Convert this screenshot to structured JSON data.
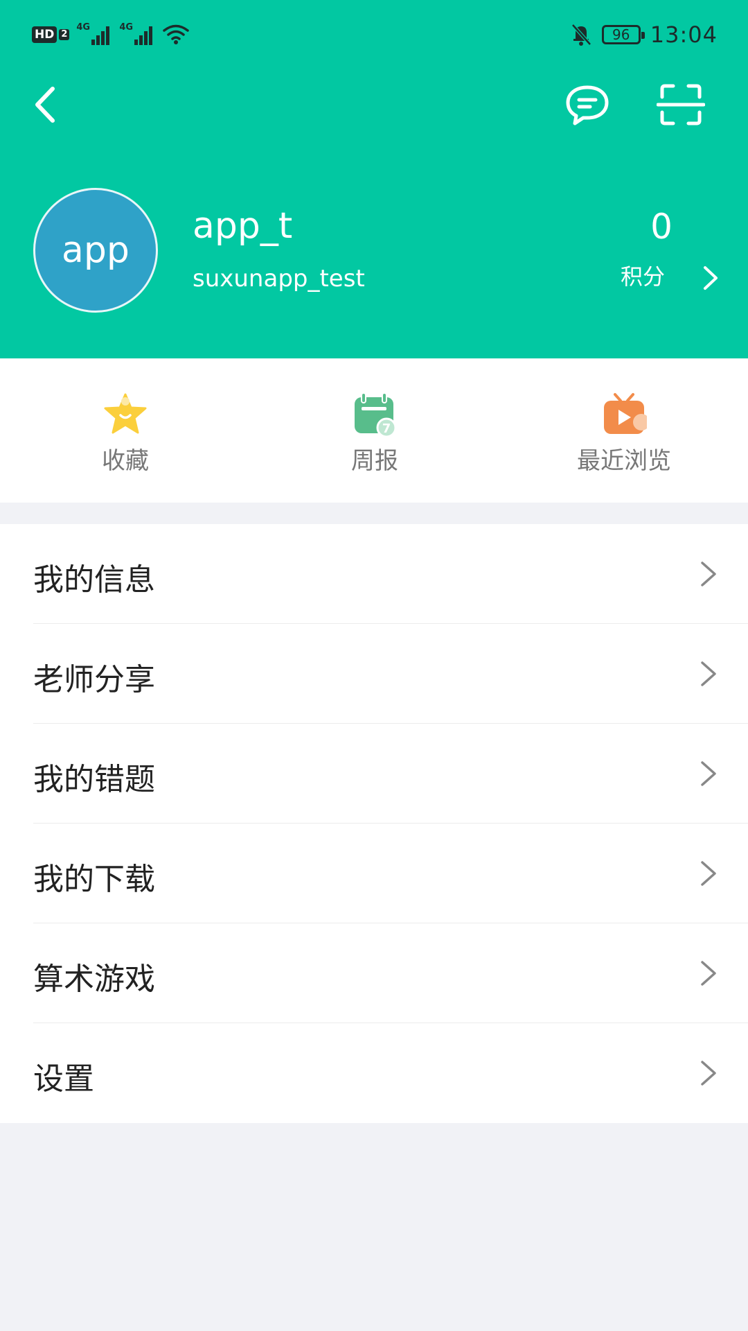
{
  "status_bar": {
    "hd_label": "HD",
    "hd_sim": "2",
    "signal1_label": "4G",
    "signal2_label": "4G",
    "battery": "96",
    "time": "13:04"
  },
  "header": {
    "avatar_text": "app",
    "username": "app_t",
    "account_id": "suxunapp_test",
    "points_value": "0",
    "points_label": "积分"
  },
  "quick_actions": [
    {
      "label": "收藏",
      "icon": "star-icon"
    },
    {
      "label": "周报",
      "icon": "calendar-icon"
    },
    {
      "label": "最近浏览",
      "icon": "tv-play-icon"
    }
  ],
  "menu": [
    {
      "label": "我的信息"
    },
    {
      "label": "老师分享"
    },
    {
      "label": "我的错题"
    },
    {
      "label": "我的下载"
    },
    {
      "label": "算术游戏"
    },
    {
      "label": "设置"
    }
  ],
  "colors": {
    "header_bg": "#02c8a2",
    "avatar_bg": "#2fa2c8",
    "page_bg": "#f1f2f6"
  }
}
